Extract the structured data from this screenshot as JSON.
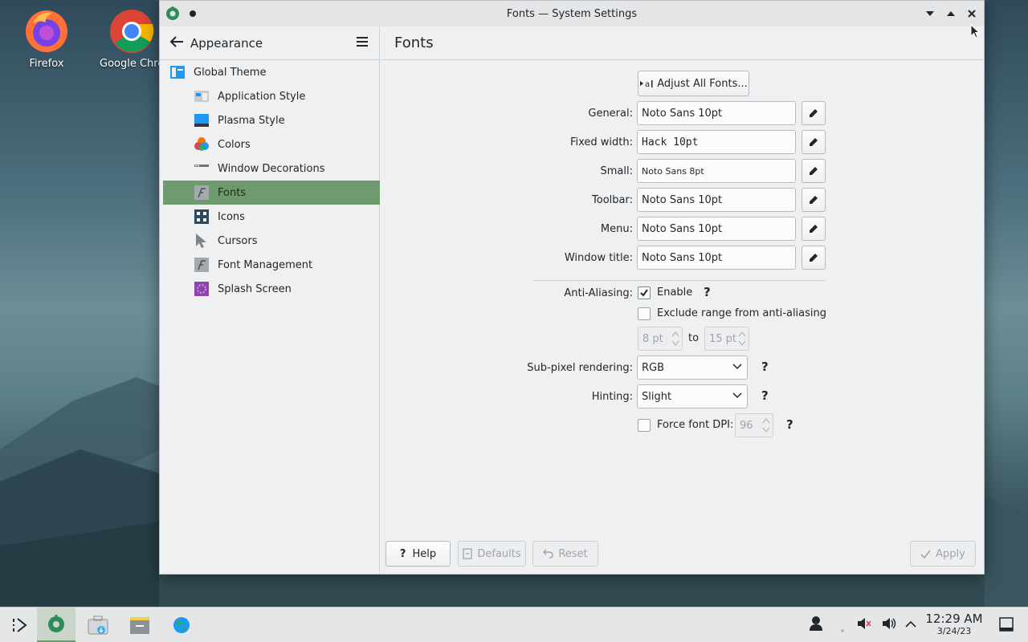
{
  "desktop": {
    "icons": [
      {
        "label": "Firefox"
      },
      {
        "label": "Google Chrome"
      }
    ]
  },
  "window": {
    "title": "Fonts — System Settings"
  },
  "sidebar": {
    "header": "Appearance",
    "items": [
      {
        "label": "Global Theme",
        "icon": "global-theme-icon",
        "level": "top"
      },
      {
        "label": "Application Style",
        "icon": "application-style-icon",
        "level": "sub"
      },
      {
        "label": "Plasma Style",
        "icon": "plasma-style-icon",
        "level": "sub"
      },
      {
        "label": "Colors",
        "icon": "colors-icon",
        "level": "sub"
      },
      {
        "label": "Window Decorations",
        "icon": "window-decorations-icon",
        "level": "sub"
      },
      {
        "label": "Fonts",
        "icon": "fonts-icon",
        "level": "sub",
        "selected": true
      },
      {
        "label": "Icons",
        "icon": "icons-icon",
        "level": "sub"
      },
      {
        "label": "Cursors",
        "icon": "cursors-icon",
        "level": "sub"
      },
      {
        "label": "Font Management",
        "icon": "font-management-icon",
        "level": "sub"
      },
      {
        "label": "Splash Screen",
        "icon": "splash-screen-icon",
        "level": "sub"
      }
    ]
  },
  "content": {
    "title": "Fonts",
    "adjust_all": "Adjust All Fonts...",
    "fonts": [
      {
        "label": "General:",
        "value": "Noto Sans 10pt"
      },
      {
        "label": "Fixed width:",
        "value": "Hack 10pt"
      },
      {
        "label": "Small:",
        "value": "Noto Sans 8pt"
      },
      {
        "label": "Toolbar:",
        "value": "Noto Sans 10pt"
      },
      {
        "label": "Menu:",
        "value": "Noto Sans 10pt"
      },
      {
        "label": "Window title:",
        "value": "Noto Sans 10pt"
      }
    ],
    "antialiasing": {
      "label": "Anti-Aliasing:",
      "enable_label": "Enable",
      "enabled": true,
      "exclude_label": "Exclude range from anti-aliasing",
      "exclude_checked": false,
      "from": "8 pt",
      "to_label": "to",
      "to": "15 pt"
    },
    "subpixel": {
      "label": "Sub-pixel rendering:",
      "value": "RGB"
    },
    "hinting": {
      "label": "Hinting:",
      "value": "Slight"
    },
    "dpi": {
      "label": "Force font DPI:",
      "value": "96",
      "checked": false
    },
    "help_mark": "?",
    "footer": {
      "help": "Help",
      "defaults": "Defaults",
      "reset": "Reset",
      "apply": "Apply"
    }
  },
  "taskbar": {
    "time": "12:29 AM",
    "date": "3/24/23"
  },
  "colors": {
    "accent": "#6f9a6f",
    "window_bg": "#eff0f1"
  }
}
